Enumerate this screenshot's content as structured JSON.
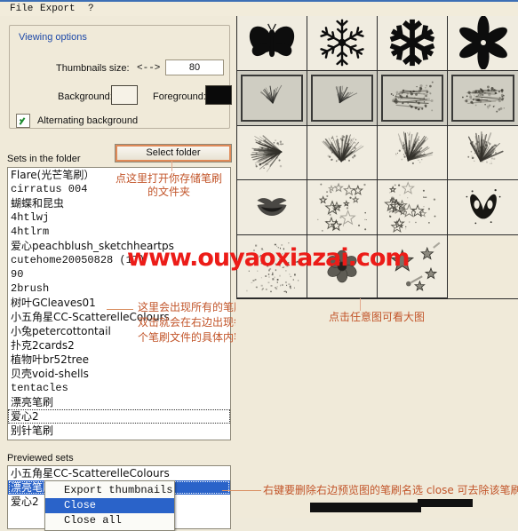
{
  "window": {
    "menu": [
      "File",
      "Export",
      "?"
    ]
  },
  "viewing_options": {
    "title": "Viewing options",
    "thumbnails_size_label": "Thumbnails size:",
    "resize_arrows": "<-->",
    "thumbnails_size_value": "80",
    "background_label": "Background:",
    "background_color": "#f6f2e7",
    "foreground_label": "Foreground:",
    "foreground_color": "#0a0a0a",
    "alternating_background_label": "Alternating background",
    "alternating_background_checked": true
  },
  "sets_panel": {
    "label": "Sets in the folder",
    "select_folder_button": "Select folder",
    "items": [
      {
        "text": "Flare(光芒笔刷）",
        "cjk": true
      },
      {
        "text": "cirratus 004",
        "cjk": false
      },
      {
        "text": "蝴蝶和昆虫",
        "cjk": true
      },
      {
        "text": "4htlwj",
        "cjk": false
      },
      {
        "text": "4htlrm",
        "cjk": false
      },
      {
        "text": "爱心peachblush_sketchheartps",
        "cjk": true
      },
      {
        "text": "cutehome20050828 (17)",
        "cjk": false
      },
      {
        "text": "90",
        "cjk": false
      },
      {
        "text": "2brush",
        "cjk": false
      },
      {
        "text": "树叶GCleaves01",
        "cjk": true
      },
      {
        "text": "小五角星CC-ScatterelleColours",
        "cjk": true
      },
      {
        "text": "小兔petercottontail",
        "cjk": true
      },
      {
        "text": "扑克2cards2",
        "cjk": true
      },
      {
        "text": "植物叶br52tree",
        "cjk": true
      },
      {
        "text": "贝壳void-shells",
        "cjk": true
      },
      {
        "text": "tentacles",
        "cjk": false
      },
      {
        "text": "漂亮笔刷",
        "cjk": true
      },
      {
        "text": "爱心2",
        "cjk": true,
        "focused": true
      },
      {
        "text": "别针笔刷",
        "cjk": true
      }
    ]
  },
  "previewed_sets": {
    "label": "Previewed sets",
    "items": [
      {
        "text": "小五角星CC-ScatterelleColours",
        "selected": false
      },
      {
        "text": "漂亮笔刷",
        "selected": true
      },
      {
        "text": "爱心2",
        "selected": false
      }
    ]
  },
  "context_menu": {
    "items": [
      {
        "label": "Export thumbnails",
        "highlighted": false
      },
      {
        "label": "Close",
        "highlighted": true
      },
      {
        "label": "Close all",
        "highlighted": false
      }
    ]
  },
  "thumbnail_grid": {
    "cells": [
      {
        "name": "butterfly-silhouette",
        "framed": false
      },
      {
        "name": "snowflake-thin",
        "framed": false
      },
      {
        "name": "snowflake-bold",
        "framed": false
      },
      {
        "name": "flower-six-petal",
        "framed": false
      },
      {
        "name": "grass-brush-1",
        "framed": true
      },
      {
        "name": "grass-brush-2",
        "framed": true
      },
      {
        "name": "splatter-brush-1",
        "framed": true
      },
      {
        "name": "splatter-brush-2",
        "framed": true
      },
      {
        "name": "burst-brush-1",
        "framed": false
      },
      {
        "name": "burst-brush-2",
        "framed": false
      },
      {
        "name": "burst-brush-3",
        "framed": false
      },
      {
        "name": "burst-brush-4",
        "framed": false
      },
      {
        "name": "lips-brush",
        "framed": false
      },
      {
        "name": "stars-trail-brush",
        "framed": false
      },
      {
        "name": "stars-cluster-brush",
        "framed": false
      },
      {
        "name": "butterfly-wings-brush",
        "framed": false
      },
      {
        "name": "sparkle-dots-brush",
        "framed": false
      },
      {
        "name": "flower-brush",
        "framed": false
      },
      {
        "name": "shooting-stars-brush",
        "framed": false
      }
    ]
  },
  "annotations": {
    "select_folder_note_line1": "点这里打开你存储笔刷",
    "select_folder_note_line2": "的文件夹",
    "sets_list_note_line1": "这里会出现所有的笔刷，",
    "sets_list_note_line2": "双击就会在右边出现每",
    "sets_list_note_line3": "个笔刷文件的具体内容",
    "grid_note": "点击任意图可看大图",
    "context_menu_note": "右键要删除右边预览图的笔刷名选 close 可去除该笔刷预览",
    "accent_color": "#c2552a"
  },
  "watermark": {
    "text": "www.ouyaoxiazai.com",
    "color": "#ec1c18"
  }
}
